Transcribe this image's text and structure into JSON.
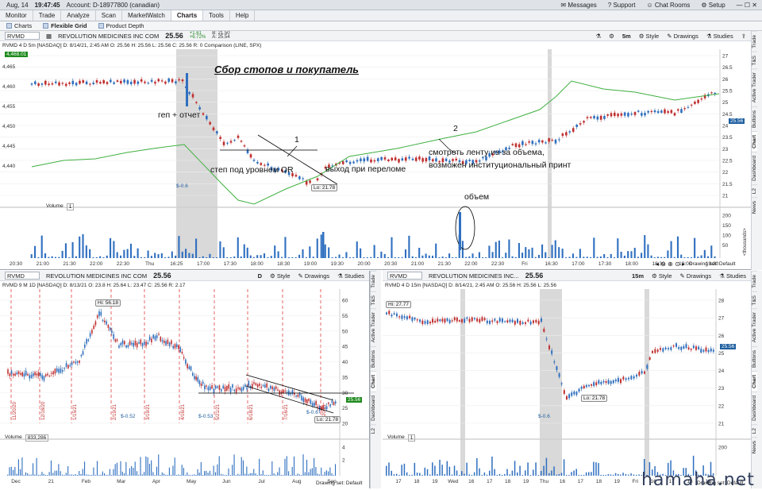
{
  "topbar": {
    "date": "Aug, 14",
    "time": "19:47:45",
    "account": "Account: D-18977800 (canadian)",
    "items": [
      "Messages",
      "Support",
      "Chat Rooms",
      "Setup"
    ]
  },
  "tabs": [
    "Monitor",
    "Trade",
    "Analyze",
    "Scan",
    "MarketWatch",
    "Charts",
    "Tools",
    "Help"
  ],
  "subtabs": [
    "Charts",
    "Flexible Grid",
    "Product Depth"
  ],
  "top": {
    "symbol": "RVMD",
    "company": "REVOLUTION MEDICINES INC COM",
    "price": "25.56",
    "chg1": "+1.61",
    "chg2": "+6.72%",
    "bid": "B: 21.50",
    "ask": "A: 25.54",
    "period": "5m",
    "info": "RVMD 4 D 5m [NASDAQ]   D: 8/14/21, 2:45 AM   O: 25.56   H: 25.56   L: 25.56   C: 25.56   R: 0   Comparison (LINE, SPX)",
    "spx_tag": "4,468.01",
    "last_tag": "25.56",
    "low_tag": "Lo: 21.78",
    "div_tag": "$-0.6",
    "volume_label": "Volume",
    "volume_val": "1",
    "vol_axis_unit": "<thousands>",
    "drawing_set": "Drawing set: Default",
    "yleft": [
      "4,465",
      "4,460",
      "4,455",
      "4,450",
      "4,445",
      "4,440"
    ],
    "yright": [
      "27",
      "26.5",
      "26",
      "25.5",
      "25",
      "24.5",
      "24",
      "23.5",
      "23",
      "22.5",
      "22",
      "21.5",
      "21"
    ],
    "volticks": [
      "200",
      "150",
      "100",
      "50"
    ],
    "xticks": [
      "20:30",
      "21:00",
      "21:30",
      "22:00",
      "22:30",
      "Thu",
      "16:25",
      "17:00",
      "17:30",
      "18:00",
      "18:30",
      "19:00",
      "19:30",
      "20:00",
      "20:30",
      "21:00",
      "21:30",
      "22:00",
      "22:30",
      "Fri",
      "16:30",
      "17:00",
      "17:30",
      "18:00",
      "18:30",
      "19:00",
      "19:30"
    ]
  },
  "annotations": {
    "title": "Сбор стопов и покупатель",
    "gap": "геп + отчет",
    "stop": "степ под уровнем OR",
    "exit": "выход при переломе",
    "n1": "1",
    "n2": "2",
    "tape1": "смотреть ленту из-за объема,",
    "tape2": "возможен институциональный принт",
    "volume": "объем"
  },
  "bl": {
    "symbol": "RVMD",
    "company": "REVOLUTION MEDICINES INC COM",
    "price": "25.56",
    "period": "D",
    "info": "RVMD 9 M 1D [NASDAQ]   D: 8/13/21   O: 23.8   H: 25.64   L: 23.47   C: 25.56   R: 2.17",
    "hi_tag": "Hi: 56.18",
    "lo_tag": "Lo: 21.78",
    "last_tag": "25.56",
    "div1": "$-0.52",
    "div2": "$-0.53",
    "div3": "$-0.6",
    "volume_label": "Volume",
    "volume_val": "833,286",
    "drawing_set": "Drawing set: Default",
    "yright": [
      "60",
      "55",
      "50",
      "45",
      "40",
      "35",
      "30",
      "25",
      "20"
    ],
    "volticks": [
      "4",
      "2"
    ],
    "xticks": [
      "Dec",
      "21",
      "Feb",
      "Mar",
      "Apr",
      "May",
      "Jun",
      "Jul",
      "Aug",
      "Sep"
    ],
    "vlabels": [
      "11/20/20",
      "12/18/20",
      "1/15/21",
      "2/19/21",
      "3/19/21",
      "4/16/21",
      "5/21/21",
      "6/18/21",
      "7/16/21",
      "8/20/21"
    ]
  },
  "br": {
    "symbol": "RVMD",
    "company": "REVOLUTION MEDICINES INC...",
    "price": "25.56",
    "period": "15m",
    "info": "RVMD 4 D 15m [NASDAQ]   D: 8/14/21, 2:45 AM   O: 25.56   H: 25.56   L: 25.56",
    "hi_tag": "Hi: 27.77",
    "lo_tag": "Lo: 21.78",
    "last_tag": "25.56",
    "div_tag": "$-0.6",
    "volume_label": "Volume",
    "volume_val": "1",
    "drawing_set": "Drawing set: Default",
    "yright": [
      "28",
      "27",
      "26",
      "25",
      "24",
      "23",
      "22",
      "21"
    ],
    "volticks": [
      "200"
    ],
    "xticks": [
      "17",
      "18",
      "19",
      "Wed",
      "16",
      "17",
      "18",
      "19",
      "Thu",
      "16",
      "17",
      "18",
      "19",
      "Fri",
      "16",
      "17",
      "18",
      "19"
    ]
  },
  "side_tabs": [
    "Trade",
    "T&S",
    "Active Trader",
    "Buttons",
    "Chart",
    "Dashboard",
    "L2",
    "News"
  ],
  "toolbar": {
    "style": "Style",
    "drawings": "Drawings",
    "studies": "Studies"
  },
  "watermark": "hamaha.net"
}
